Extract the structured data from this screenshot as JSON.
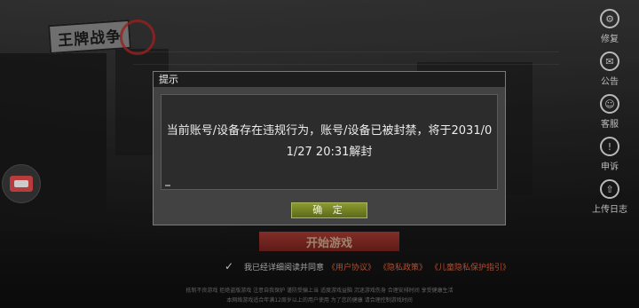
{
  "game": {
    "logo_text": "王牌战争"
  },
  "side_menu": [
    {
      "icon": "wrench-icon",
      "glyph": "⚙",
      "label": "修复"
    },
    {
      "icon": "notice-icon",
      "glyph": "✉",
      "label": "公告"
    },
    {
      "icon": "service-icon",
      "glyph": "☺",
      "label": "客服"
    },
    {
      "icon": "complain-icon",
      "glyph": "!",
      "label": "申诉"
    },
    {
      "icon": "upload-icon",
      "glyph": "⇧",
      "label": "上传日志"
    }
  ],
  "main": {
    "start_button": "开始游戏",
    "agree_prefix": "我已经详细阅读并同意",
    "links": [
      "《用户协议》",
      "《隐私政策》",
      "《儿童隐私保护指引》"
    ],
    "footer_line1": "抵制不良游戏 拒绝盗版游戏 注意自我保护 谨防受骗上当 适度游戏益脑 沉迷游戏伤身 合理安排时间 享受健康生活",
    "footer_line2": "本网络游戏适合年满12周岁以上的用户使用 为了您的健康 请合理控制游戏时间"
  },
  "dialog": {
    "title": "提示",
    "message": "当前账号/设备存在违规行为，账号/设备已被封禁，将于2031/01/27 20:31解封",
    "confirm": "确 定"
  },
  "colors": {
    "link": "#e0603a",
    "confirm_bg": "#6f7e22",
    "start_bg": "#b0352e"
  }
}
